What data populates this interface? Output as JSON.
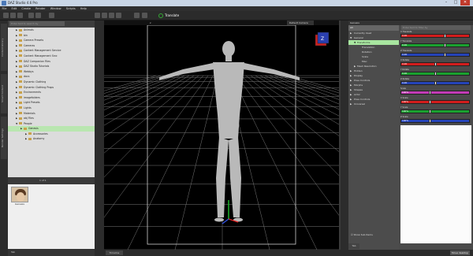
{
  "window": {
    "title": "DAZ Studio 4.6 Pro",
    "controls": [
      "minimize-icon",
      "maximize-icon",
      "close-icon"
    ]
  },
  "menu": [
    "File",
    "Edit",
    "Create",
    "Render",
    "Window",
    "Scripts",
    "Help"
  ],
  "toolbar": {
    "translate_label": "Translate"
  },
  "left_tabs": [
    "Content Library",
    "Smart Content",
    "Render Settings"
  ],
  "content_library": {
    "search_placeholder": "Enter text to search by",
    "tree": [
      {
        "label": "Animals",
        "level": 0,
        "expanded": false
      },
      {
        "label": "bin",
        "level": 0,
        "expanded": false
      },
      {
        "label": "Camera Presets",
        "level": 0,
        "expanded": false
      },
      {
        "label": "Cameras",
        "level": 0,
        "expanded": false
      },
      {
        "label": "Content Management Service",
        "level": 0,
        "expanded": false
      },
      {
        "label": "Content Management Srvc",
        "level": 0,
        "expanded": false
      },
      {
        "label": "DAZ Companion Files",
        "level": 0,
        "expanded": false
      },
      {
        "label": "DAZ Studio Tutorials",
        "level": 0,
        "expanded": false
      },
      {
        "label": "Webbys",
        "level": 0,
        "expanded": false
      },
      {
        "label": "docs",
        "level": 0,
        "expanded": false
      },
      {
        "label": "Dynamic Clothing",
        "level": 0,
        "expanded": false
      },
      {
        "label": "Dynamic Clothing Props",
        "level": 0,
        "expanded": false
      },
      {
        "label": "Environments",
        "level": 0,
        "expanded": false
      },
      {
        "label": "imagefolders",
        "level": 0,
        "expanded": false
      },
      {
        "label": "Light Presets",
        "level": 0,
        "expanded": false
      },
      {
        "label": "Lights",
        "level": 0,
        "expanded": false
      },
      {
        "label": "Materials",
        "level": 0,
        "expanded": false
      },
      {
        "label": "obj Files",
        "level": 0,
        "expanded": false
      },
      {
        "label": "People",
        "level": 0,
        "expanded": true
      },
      {
        "label": "Genesis",
        "level": 1,
        "expanded": false,
        "selected": true
      },
      {
        "label": "Accessories",
        "level": 2,
        "expanded": false
      },
      {
        "label": "Anatomy",
        "level": 2,
        "expanded": false
      }
    ],
    "pager": "1 of 1",
    "thumbnails": [
      {
        "label": "Genesis"
      }
    ],
    "bottom_tab": "Tab"
  },
  "viewport": {
    "label": "z",
    "camera": "Default Camera",
    "gizmo_letter": "Z"
  },
  "bottom_bar": {
    "tab_label": "Timeline",
    "status": "Move desktop"
  },
  "parameters": {
    "header": "Genesis",
    "all_label": "All",
    "tree": [
      {
        "label": "Currently Used",
        "level": 0
      },
      {
        "label": "General",
        "level": 0,
        "expanded": true
      },
      {
        "label": "Transforms",
        "level": 1,
        "expanded": true,
        "selected": true
      },
      {
        "label": "Translation",
        "level": 2
      },
      {
        "label": "Rotation",
        "level": 2
      },
      {
        "label": "Scale",
        "level": 2
      },
      {
        "label": "Misc",
        "level": 2
      },
      {
        "label": "Mesh Resolution",
        "level": 1
      },
      {
        "label": "Hidden",
        "level": 0
      },
      {
        "label": "Display",
        "level": 0
      },
      {
        "label": "Pose Controls",
        "level": 0
      },
      {
        "label": "Morphs",
        "level": 0
      },
      {
        "label": "Shapes",
        "level": 0
      },
      {
        "label": "Actor",
        "level": 0
      },
      {
        "label": "Pose Controls",
        "level": 0
      },
      {
        "label": "Universal",
        "level": 0
      }
    ],
    "show_sub_items": "Show Sub Items",
    "filter_placeholder": "Enter text to filter by",
    "sliders": [
      {
        "label": "X Translate",
        "value": "0.00",
        "color": "#d21d1d",
        "level": 0.65
      },
      {
        "label": "Y Translate",
        "value": "0.00",
        "color": "#1aa12f",
        "level": 0.65
      },
      {
        "label": "Z Translate",
        "value": "0.00",
        "color": "#2543b8",
        "level": 0.65
      },
      {
        "label": "X Rotate",
        "value": "0.00",
        "color": "#d21d1d",
        "level": 0.5
      },
      {
        "label": "Y Rotate",
        "value": "0.00",
        "color": "#1aa12f",
        "level": 0.5
      },
      {
        "label": "Z Rotate",
        "value": "0.00",
        "color": "#2543b8",
        "level": 0.5
      },
      {
        "label": "Scale",
        "value": "100%",
        "color": "#c23bb6",
        "level": 0.42
      },
      {
        "label": "X Scale",
        "value": "100%",
        "color": "#d21d1d",
        "level": 0.42
      },
      {
        "label": "Y Scale",
        "value": "100%",
        "color": "#1aa12f",
        "level": 0.42
      },
      {
        "label": "Z Scale",
        "value": "100%",
        "color": "#2543b8",
        "level": 0.42
      }
    ],
    "bottom_tab": "Tab"
  },
  "colors": {
    "accent_green": "#a8e6a0",
    "bg_dark": "#2c2c2c"
  }
}
